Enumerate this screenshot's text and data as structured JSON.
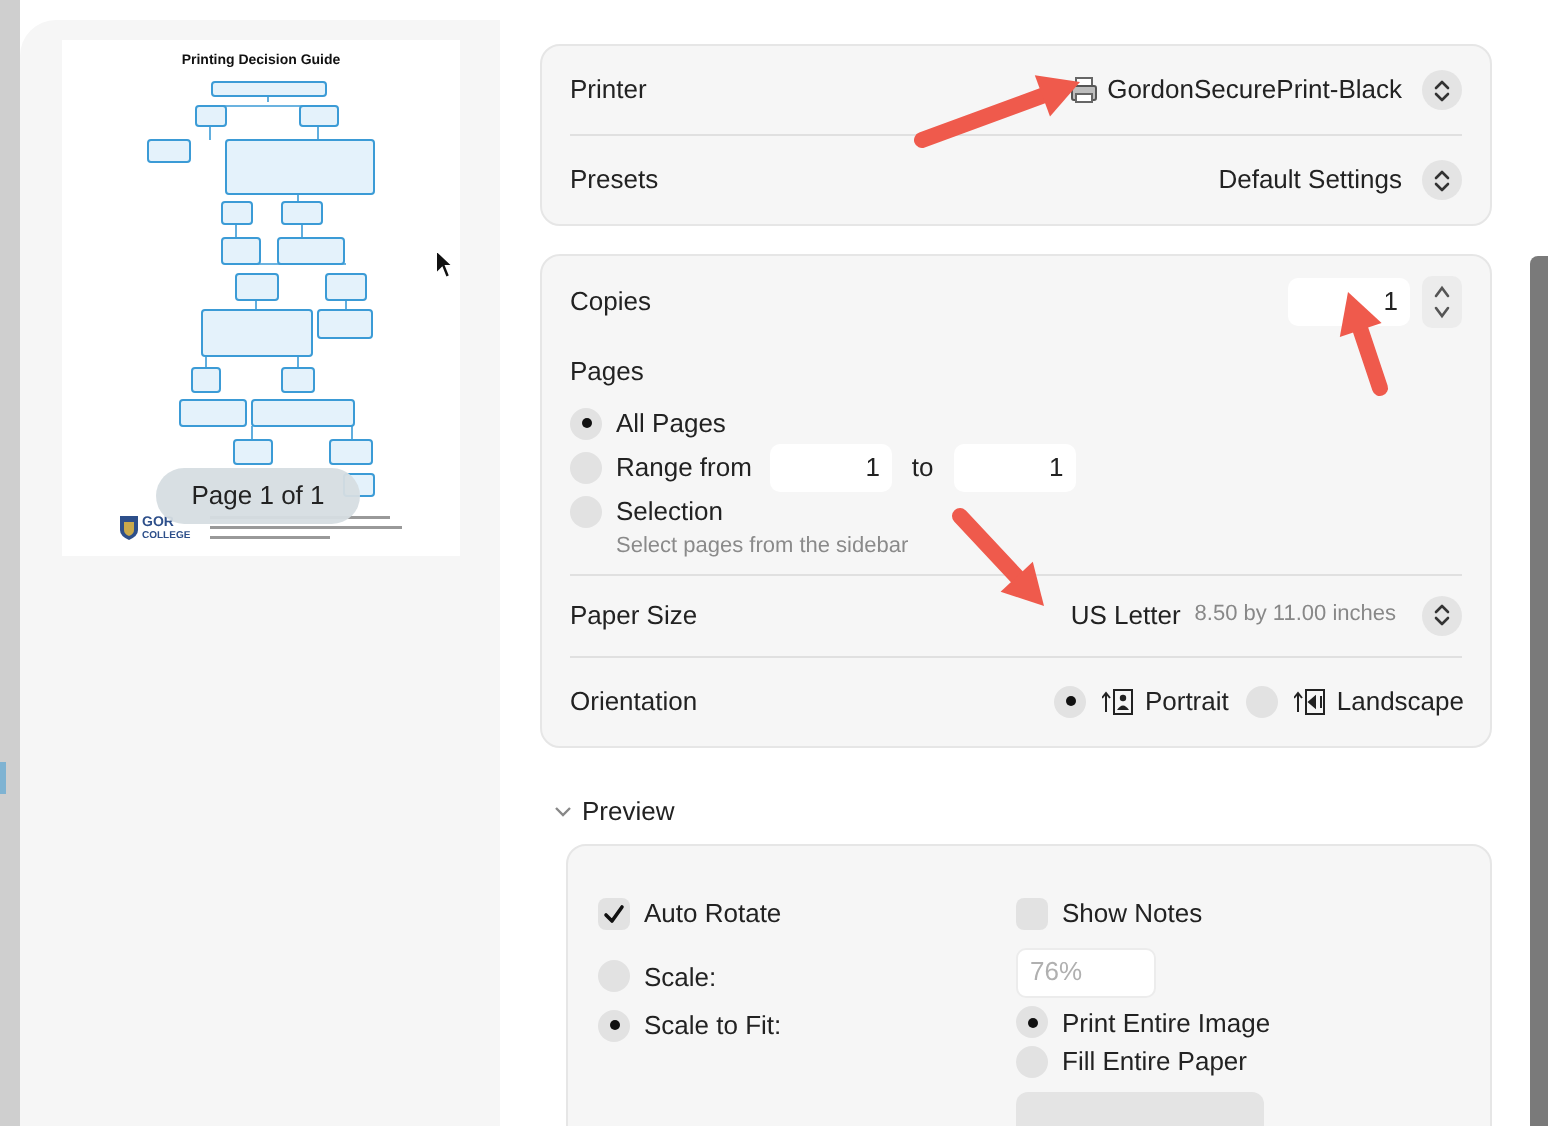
{
  "document_preview": {
    "title": "Printing Decision Guide",
    "logo_lines": [
      "GOR",
      "COLLEGE"
    ],
    "page_indicator": "Page 1 of 1"
  },
  "printer": {
    "label": "Printer",
    "value": "GordonSecurePrint-Black"
  },
  "presets": {
    "label": "Presets",
    "value": "Default Settings"
  },
  "copies": {
    "label": "Copies",
    "value": "1"
  },
  "pages": {
    "label": "Pages",
    "options": [
      {
        "kind": "plain",
        "label": "All Pages",
        "selected": true
      },
      {
        "kind": "range",
        "label": "Range from",
        "selected": false,
        "from": "1",
        "to_label": "to",
        "to": "1"
      },
      {
        "kind": "hint",
        "label": "Selection",
        "selected": false,
        "hint": "Select pages from the sidebar"
      }
    ]
  },
  "paper_size": {
    "label": "Paper Size",
    "value": "US Letter",
    "detail": "8.50 by 11.00 inches"
  },
  "orientation": {
    "label": "Orientation",
    "options": [
      {
        "kind": "portrait",
        "label": "Portrait",
        "selected": true
      },
      {
        "kind": "landscape",
        "label": "Landscape",
        "selected": false
      }
    ]
  },
  "preview_section": {
    "title": "Preview",
    "expanded": true,
    "checkboxes": [
      {
        "label": "Auto Rotate",
        "checked": true
      },
      {
        "label": "Show Notes",
        "checked": false
      }
    ],
    "scale_options": [
      {
        "label": "Scale:",
        "selected": false
      },
      {
        "label": "Scale to Fit:",
        "selected": true
      }
    ],
    "scale_value": "76%",
    "fit_options": [
      {
        "label": "Print Entire Image",
        "selected": true
      },
      {
        "label": "Fill Entire Paper",
        "selected": false
      }
    ]
  }
}
